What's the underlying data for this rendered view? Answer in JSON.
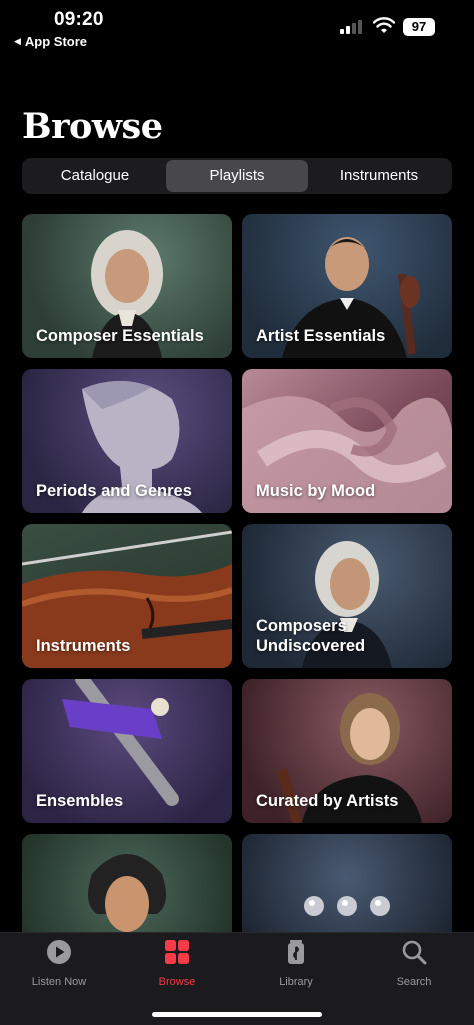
{
  "status": {
    "time": "09:20",
    "back_label": "App Store",
    "battery": "97"
  },
  "page": {
    "title": "Browse"
  },
  "segments": [
    {
      "label": "Catalogue",
      "active": false
    },
    {
      "label": "Playlists",
      "active": true
    },
    {
      "label": "Instruments",
      "active": false
    }
  ],
  "cards": [
    {
      "label": "Composer Essentials"
    },
    {
      "label": "Artist Essentials"
    },
    {
      "label": "Periods and Genres"
    },
    {
      "label": "Music by Mood"
    },
    {
      "label": "Instruments"
    },
    {
      "label": "Composers\nUndiscovered"
    },
    {
      "label": "Ensembles"
    },
    {
      "label": "Curated by Artists"
    },
    {
      "label": ""
    },
    {
      "label": ""
    }
  ],
  "tabbar": {
    "items": [
      {
        "label": "Listen Now",
        "icon": "play-circle-icon",
        "active": false
      },
      {
        "label": "Browse",
        "icon": "browse-grid-icon",
        "active": true
      },
      {
        "label": "Library",
        "icon": "library-icon",
        "active": false
      },
      {
        "label": "Search",
        "icon": "search-icon",
        "active": false
      }
    ]
  },
  "colors": {
    "accent": "#f43b47",
    "background": "#000000",
    "tabbar": "#1b1b1d"
  }
}
